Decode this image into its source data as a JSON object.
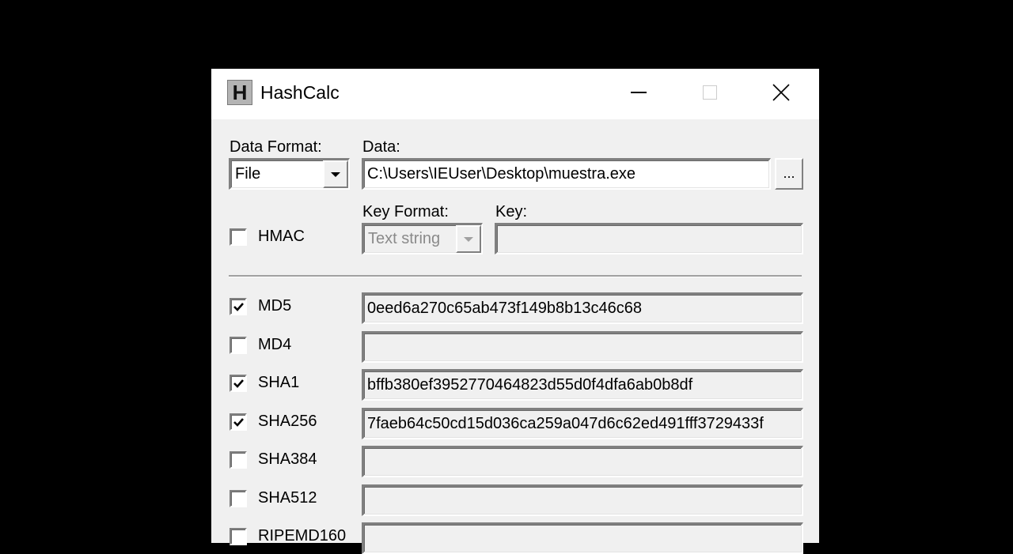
{
  "window": {
    "title": "HashCalc",
    "app_icon_letter": "H",
    "controls": {
      "minimize": "minimize",
      "maximize": "maximize",
      "close": "close"
    }
  },
  "data_format": {
    "label": "Data Format:",
    "selected": "File"
  },
  "data": {
    "label": "Data:",
    "value": "C:\\Users\\IEUser\\Desktop\\muestra.exe",
    "browse_label": "..."
  },
  "hmac": {
    "label": "HMAC",
    "checked": false
  },
  "key_format": {
    "label": "Key Format:",
    "selected": "Text string",
    "disabled": true
  },
  "key": {
    "label": "Key:",
    "value": ""
  },
  "hashes": [
    {
      "name": "MD5",
      "checked": true,
      "value": "0eed6a270c65ab473f149b8b13c46c68"
    },
    {
      "name": "MD4",
      "checked": false,
      "value": ""
    },
    {
      "name": "SHA1",
      "checked": true,
      "value": "bffb380ef3952770464823d55d0f4dfa6ab0b8df"
    },
    {
      "name": "SHA256",
      "checked": true,
      "value": "7faeb64c50cd15d036ca259a047d6c62ed491fff3729433f"
    },
    {
      "name": "SHA384",
      "checked": false,
      "value": ""
    },
    {
      "name": "SHA512",
      "checked": false,
      "value": ""
    },
    {
      "name": "RIPEMD160",
      "checked": false,
      "value": ""
    }
  ]
}
